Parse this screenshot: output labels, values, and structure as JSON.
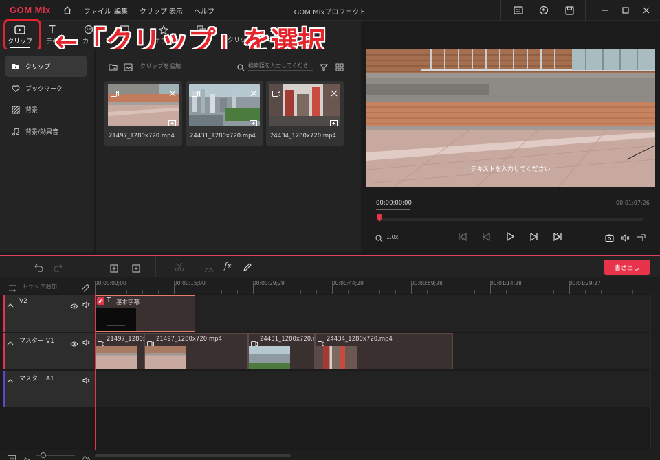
{
  "app": {
    "logo": "GOM Mix",
    "window_title": "GOM Mixプロフェクト",
    "menu": [
      "ファイル",
      "編集",
      "クリップ",
      "表示",
      "ヘルプ"
    ]
  },
  "tabs": {
    "clip": "クリップ",
    "text": "テキ",
    "sticker": "カー",
    "template": "プ",
    "effect": "エフェ",
    "overlay": "ーバ",
    "transition": "クリップ",
    "transition2": "ジション"
  },
  "sidebar": {
    "items": [
      {
        "label": "クリップ",
        "icon": "clip-icon"
      },
      {
        "label": "ブックマーク",
        "icon": "heart-icon"
      },
      {
        "label": "背景",
        "icon": "background-icon"
      },
      {
        "label": "背景/効果音",
        "icon": "music-icon"
      }
    ]
  },
  "media": {
    "add_clip": "| クリップを追加",
    "search_placeholder": "検索語を入力してくださ...",
    "clips": [
      {
        "name": "21497_1280x720.mp4"
      },
      {
        "name": "24431_1280x720.mp4"
      },
      {
        "name": "24434_1280x720.mp4"
      }
    ]
  },
  "preview": {
    "overlay_text": "テキストを入力してください",
    "current_time": "00:00:00;00",
    "total_time": "00:01:07;26",
    "zoom": "1.0x",
    "progress": 0.0
  },
  "timeline": {
    "export_label": "書き出し",
    "add_track": "トラック追加",
    "ruler_marks": [
      "00:00:00;00",
      "00:00:15;00",
      "00:00:29;29",
      "00:00:44;29",
      "00:00:59;28",
      "00:01:14;28",
      "00:01:29;27"
    ],
    "tracks": [
      {
        "name": "V2"
      },
      {
        "name": "マスター V1"
      },
      {
        "name": "マスター A1"
      }
    ],
    "v2_clip": "基本字幕",
    "v1_clips": [
      "21497_1280x...",
      "21497_1280x720.mp4",
      "24431_1280x720.m...",
      "24434_1280x720.mp4"
    ]
  },
  "annotation": {
    "callout": "←「クリップ」を選択"
  },
  "colors": {
    "accent": "#e8344a",
    "callout": "#e6242c"
  }
}
